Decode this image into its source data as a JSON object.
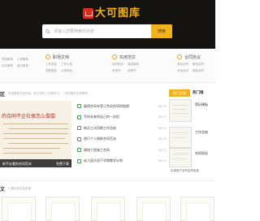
{
  "header": {
    "logo_text": "大可图库",
    "search_placeholder": "请输入您要搜索的内容",
    "search_button": "搜索"
  },
  "categories": [
    {
      "title": "职场文档",
      "links": [
        "工作总结",
        "工作计划",
        "述职报告",
        "心得体会"
      ]
    },
    {
      "title": "实用范文",
      "links": [
        "合同协议",
        "演讲致辞",
        "申请书",
        "证明书"
      ]
    },
    {
      "title": "合同协议",
      "links": [
        "劳动合同",
        "租赁合同",
        "买卖合同",
        "借款合同"
      ]
    }
  ],
  "left_cat": {
    "links": [
      "学前教育",
      "小学教育",
      "初中教育",
      "高中教育"
    ]
  },
  "section1": {
    "title": "区",
    "subtitle": "丰富精选文档内容，助力您的工作和学习，一站式解决文档需求"
  },
  "featured": {
    "title": "的合同不企社保怎么偿偿",
    "footer_left": "新手必看的合同范本",
    "footer_right": "免费下载"
  },
  "list": [
    {
      "text": "雇佣合同未签订劳动合同的赔偿",
      "date": "09-11"
    },
    {
      "text": "写给未来的自己的一封信",
      "date": "09-11"
    },
    {
      "text": "新员工试用期工作总结",
      "date": "09-11"
    },
    {
      "text": "银行个人借款合同范本",
      "date": "09-11"
    },
    {
      "text": "建筑工程施工合同",
      "date": "09-11"
    },
    {
      "text": "幼儿园大班下学期教学计划",
      "date": "09-11"
    },
    {
      "text": "公司年终总结报告范文",
      "date": "09-11"
    }
  ],
  "tabs": {
    "active": "热门文档",
    "other": "热门推"
  },
  "right_items": [
    {
      "text": "简历模板"
    },
    {
      "text": "工作总结"
    },
    {
      "text": "合同协议"
    }
  ],
  "right_caption": "实用电子合同合同免费",
  "section2": {
    "title": "文",
    "subtitle": "汇集优质文档资源"
  }
}
